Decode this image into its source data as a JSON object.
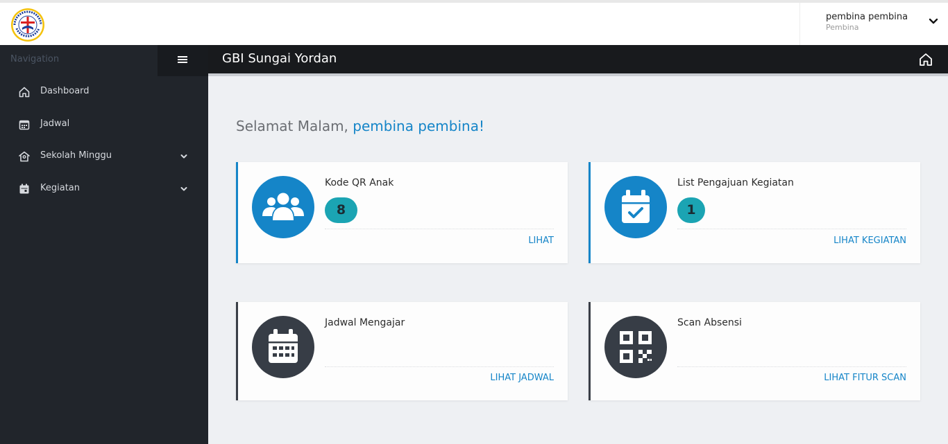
{
  "brand": {
    "logo_icon": "gbi-church-seal-icon",
    "logo_text": "GEREJA BETHEL INDONESIA"
  },
  "user": {
    "name": "pembina pembina",
    "role": "Pembina"
  },
  "sidebar": {
    "title": "Navigation",
    "items": [
      {
        "label": "Dashboard",
        "icon": "home-icon"
      },
      {
        "label": "Jadwal",
        "icon": "calendar-icon"
      },
      {
        "label": "Sekolah Minggu",
        "icon": "school-icon",
        "expandable": true
      },
      {
        "label": "Kegiatan",
        "icon": "calendar-event-icon",
        "expandable": true
      }
    ]
  },
  "header": {
    "title": "GBI Sungai Yordan"
  },
  "greeting": {
    "prefix": "Selamat Malam, ",
    "name": "pembina pembina!"
  },
  "cards": [
    {
      "title": "Kode QR Anak",
      "count": "8",
      "link": "LIHAT",
      "icon": "users-icon",
      "color": "#1585c8"
    },
    {
      "title": "List Pengajuan Kegiatan",
      "count": "1",
      "link": "LIHAT KEGIATAN",
      "icon": "calendar-check-icon",
      "color": "#1585c8"
    },
    {
      "title": "Jadwal Mengajar",
      "link": "LIHAT JADWAL",
      "icon": "calendar-grid-icon",
      "color": "#373d46"
    },
    {
      "title": "Scan Absensi",
      "link": "LIHAT FITUR SCAN",
      "icon": "qr-code-icon",
      "color": "#373d46"
    }
  ],
  "colors": {
    "accent": "#1585c8",
    "badge": "#1ba4b3",
    "sidebar": "#21252b",
    "header": "#181a1d"
  }
}
